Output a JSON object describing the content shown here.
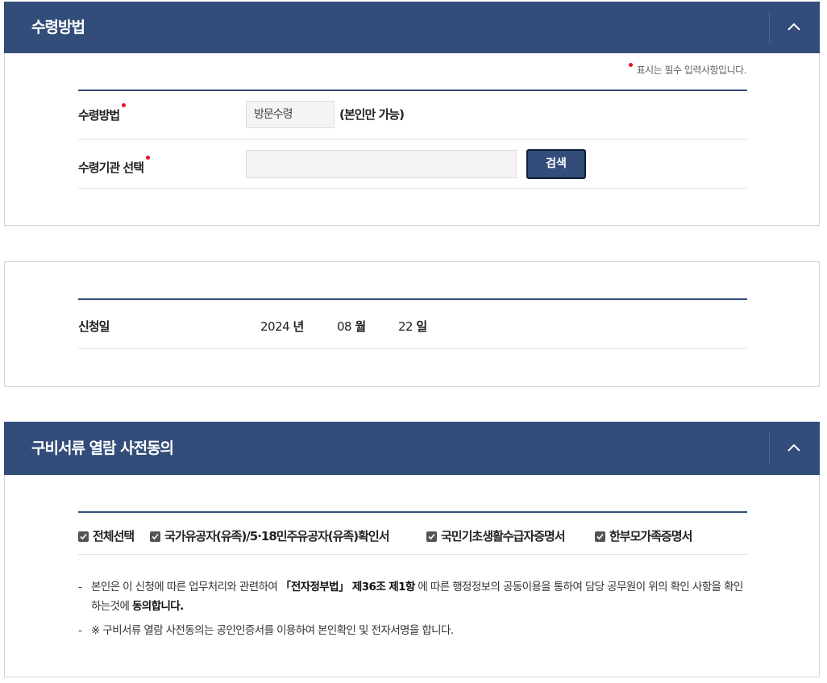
{
  "receive": {
    "title": "수령방법",
    "required_note": "표시는 필수 입력사항입니다.",
    "method_label": "수령방법",
    "method_value": "방문수령",
    "method_note": "(본인만 가능)",
    "agency_label": "수령기관 선택",
    "agency_value": "",
    "search_label": "검색"
  },
  "application": {
    "date_label": "신청일",
    "year": "2024",
    "year_unit": "년",
    "month": "08",
    "month_unit": "월",
    "day": "22",
    "day_unit": "일"
  },
  "consent": {
    "title": "구비서류 열람 사전동의",
    "checks": [
      {
        "label": "전체선택",
        "checked": true
      },
      {
        "label": "국가유공자(유족)/5·18민주유공자(유족)확인서",
        "checked": true
      },
      {
        "label": "국민기초생활수급자증명서",
        "checked": true
      },
      {
        "label": "한부모가족증명서",
        "checked": true
      }
    ],
    "notice1_a": "본인은 이 신청에 따른 업무처리와 관련하여 ",
    "notice1_b": "「전자정부법」 제36조 제1항",
    "notice1_c": " 에 따른 행정정보의 공동이용을 통하여 담당 공무원이 위의 확인 사항을 확인하는것에 ",
    "notice1_d": "동의합니다.",
    "notice2": "※ 구비서류 열람 사전동의는 공인인증서를 이용하여 본인확인 및 전자서명을 합니다.",
    "dash": "-"
  },
  "colors": {
    "header_bg": "#334d7a",
    "required_dot": "#e2141b"
  }
}
